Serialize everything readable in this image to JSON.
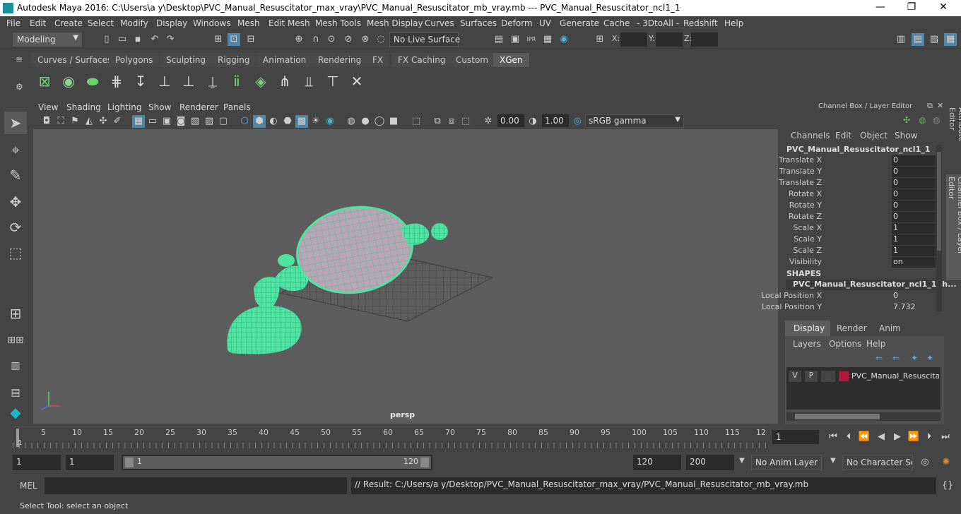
{
  "window": {
    "title": "Autodesk Maya 2016: C:\\Users\\a y\\Desktop\\PVC_Manual_Resuscitator_max_vray\\PVC_Manual_Resuscitator_mb_vray.mb   ---   PVC_Manual_Resuscitator_ncl1_1",
    "minimize": "—",
    "maximize": "❐",
    "close": "✕"
  },
  "menu": [
    "File",
    "Edit",
    "Create",
    "Select",
    "Modify",
    "Display",
    "Windows",
    "Mesh",
    "Edit Mesh",
    "Mesh Tools",
    "Mesh Display",
    "Curves",
    "Surfaces",
    "Deform",
    "UV",
    "Generate",
    "Cache",
    "- 3DtoAll -",
    "Redshift",
    "Help"
  ],
  "statusline": {
    "mode": "Modeling",
    "live_surface": "No Live Surface",
    "x_label": "X:",
    "y_label": "Y:",
    "z_label": "Z:"
  },
  "shelf_tabs": [
    "Curves / Surfaces",
    "Polygons",
    "Sculpting",
    "Rigging",
    "Animation",
    "Rendering",
    "FX",
    "FX Caching",
    "Custom",
    "XGen"
  ],
  "shelf_active": "XGen",
  "panel_menu": [
    "View",
    "Shading",
    "Lighting",
    "Show",
    "Renderer",
    "Panels"
  ],
  "panel_toolbar": {
    "exposure": "0.00",
    "gamma": "1.00",
    "colorspace": "sRGB gamma"
  },
  "viewport": {
    "camera": "persp"
  },
  "channelbox": {
    "header": "Channel Box / Layer Editor",
    "menu": [
      "Channels",
      "Edit",
      "Object",
      "Show"
    ],
    "object": "PVC_Manual_Resuscitator_ncl1_1",
    "channels": [
      {
        "label": "Translate X",
        "value": "0"
      },
      {
        "label": "Translate Y",
        "value": "0"
      },
      {
        "label": "Translate Z",
        "value": "0"
      },
      {
        "label": "Rotate X",
        "value": "0"
      },
      {
        "label": "Rotate Y",
        "value": "0"
      },
      {
        "label": "Rotate Z",
        "value": "0"
      },
      {
        "label": "Scale X",
        "value": "1"
      },
      {
        "label": "Scale Y",
        "value": "1"
      },
      {
        "label": "Scale Z",
        "value": "1"
      },
      {
        "label": "Visibility",
        "value": "on"
      }
    ],
    "shapes_title": "SHAPES",
    "shape_name": "PVC_Manual_Resuscitator_ncl1_1Sh...",
    "shape_channels": [
      {
        "label": "Local Position X",
        "value": "0"
      },
      {
        "label": "Local Position Y",
        "value": "7.732"
      }
    ],
    "layer_tabs": [
      "Display",
      "Render",
      "Anim"
    ],
    "layer_menu": [
      "Layers",
      "Options",
      "Help"
    ],
    "layer": {
      "v": "V",
      "p": "P",
      "name": "PVC_Manual_Resuscitato",
      "color": "#b3173a"
    },
    "side_tabs": [
      "Attribute Editor",
      "Channel Box / Layer Editor"
    ]
  },
  "timeline": {
    "ticks": [
      "5",
      "10",
      "15",
      "20",
      "25",
      "30",
      "35",
      "40",
      "45",
      "50",
      "55",
      "60",
      "65",
      "70",
      "75",
      "80",
      "85",
      "90",
      "95",
      "100",
      "105",
      "110",
      "115",
      "12"
    ],
    "current_frame_marker": "1",
    "current_frame": "1"
  },
  "range": {
    "start": "1",
    "playback_start": "1",
    "slider_start": "1",
    "slider_end": "120",
    "playback_end": "120",
    "end": "200",
    "anim_layer": "No Anim Layer",
    "character_set": "No Character Set"
  },
  "cmdline": {
    "lang": "MEL",
    "result": "// Result: C:/Users/a y/Desktop/PVC_Manual_Resuscitator_max_vray/PVC_Manual_Resuscitator_mb_vray.mb"
  },
  "helpline": "Select Tool: select an object",
  "colors": {
    "wire": "#4de3a0",
    "viewport_bg": "#5d5d5d",
    "accent": "#5285a6"
  }
}
